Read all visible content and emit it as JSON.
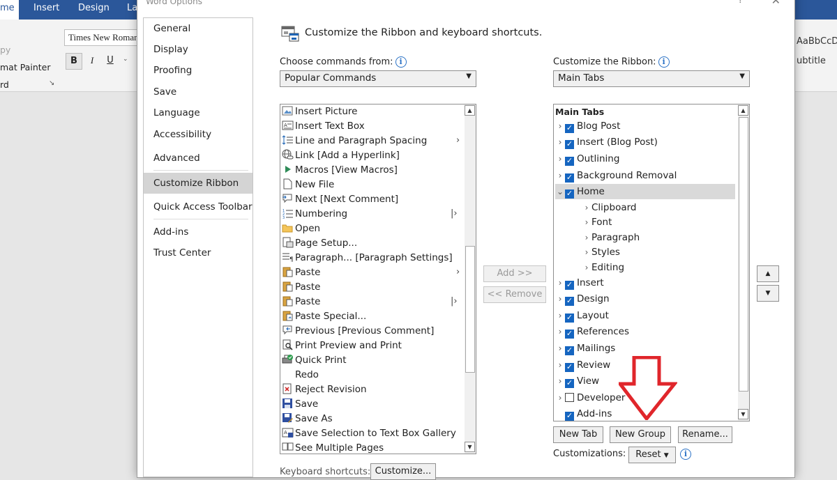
{
  "word": {
    "tabs": [
      "me",
      "Insert",
      "Design",
      "La"
    ],
    "ribbon": {
      "copy_partial": "py",
      "format_painter_partial": "mat Painter",
      "clipboard_partial": "rd",
      "font_name": "Times New Roman",
      "bold": "B",
      "italic": "I",
      "underline": "U",
      "style_preview": "AaBbCcD",
      "style_name_partial": "ubtitle"
    }
  },
  "dialog": {
    "title": "Word Options",
    "help": "?",
    "close": "✕",
    "nav": [
      "General",
      "Display",
      "Proofing",
      "Save",
      "Language",
      "Accessibility",
      "Advanced",
      "Customize Ribbon",
      "Quick Access Toolbar",
      "Add-ins",
      "Trust Center"
    ],
    "heading": "Customize the Ribbon and keyboard shortcuts.",
    "choose_label": "Choose commands from:",
    "choose_value": "Popular Commands",
    "customize_label": "Customize the Ribbon:",
    "customize_value": "Main Tabs",
    "commands": [
      "Insert Picture",
      "Insert Text Box",
      "Line and Paragraph Spacing",
      "Link [Add a Hyperlink]",
      "Macros [View Macros]",
      "New File",
      "Next [Next Comment]",
      "Numbering",
      "Open",
      "Page Setup...",
      "Paragraph... [Paragraph Settings]",
      "Paste",
      "Paste",
      "Paste",
      "Paste Special...",
      "Previous [Previous Comment]",
      "Print Preview and Print",
      "Quick Print",
      "Redo",
      "Reject Revision",
      "Save",
      "Save As",
      "Save Selection to Text Box Gallery",
      "See Multiple Pages"
    ],
    "tree_header": "Main Tabs",
    "tree": [
      "Blog Post",
      "Insert (Blog Post)",
      "Outlining",
      "Background Removal",
      "Home",
      "Clipboard",
      "Font",
      "Paragraph",
      "Styles",
      "Editing",
      "Insert",
      "Design",
      "Layout",
      "References",
      "Mailings",
      "Review",
      "View",
      "Developer",
      "Add-ins"
    ],
    "add_button": "Add >>",
    "remove_button": "<< Remove",
    "new_tab": "New Tab",
    "new_group": "New Group",
    "rename": "Rename...",
    "customizations_label": "Customizations:",
    "reset": "Reset",
    "keyboard_label": "Keyboard shortcuts:",
    "customize_btn": "Customize...",
    "annotation_color": "#e0262b"
  }
}
